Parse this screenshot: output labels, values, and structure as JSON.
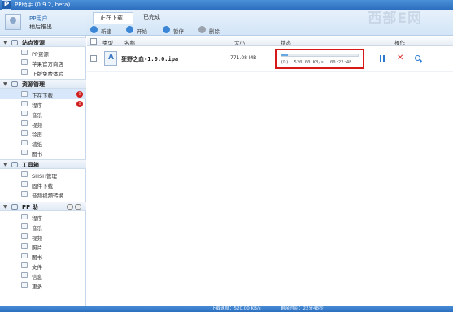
{
  "app": {
    "title": "PP助手 (0.9.2, beta)",
    "logo": "P",
    "watermark": "西部E网"
  },
  "user": {
    "name": "PP用户",
    "logout_label": "稍后推出"
  },
  "sidebar": {
    "sections": [
      {
        "title": "站点资源",
        "items": [
          {
            "label": "PP资源",
            "icon": "pp-resource-icon"
          },
          {
            "label": "苹果官方商店",
            "icon": "apple-store-icon"
          },
          {
            "label": "正版免费体验",
            "icon": "free-trial-icon"
          }
        ]
      },
      {
        "title": "资源管理",
        "items": [
          {
            "label": "正在下载",
            "icon": "download-icon",
            "badge": "!"
          },
          {
            "label": "程序",
            "icon": "app-icon",
            "badge": "!"
          },
          {
            "label": "音乐",
            "icon": "music-icon"
          },
          {
            "label": "视频",
            "icon": "video-icon"
          },
          {
            "label": "铃声",
            "icon": "ringtone-icon"
          },
          {
            "label": "墙纸",
            "icon": "wallpaper-icon"
          },
          {
            "label": "图书",
            "icon": "book-icon"
          }
        ]
      },
      {
        "title": "工具箱",
        "items": [
          {
            "label": "SHSH管理",
            "icon": "shsh-icon"
          },
          {
            "label": "固件下载",
            "icon": "firmware-icon"
          },
          {
            "label": "音频视频转换",
            "icon": "convert-icon"
          }
        ]
      },
      {
        "title": "PP 助",
        "items": [
          {
            "label": "程序",
            "icon": "app-icon"
          },
          {
            "label": "音乐",
            "icon": "music-icon"
          },
          {
            "label": "视频",
            "icon": "video-icon"
          },
          {
            "label": "照片",
            "icon": "photo-icon"
          },
          {
            "label": "图书",
            "icon": "book-icon"
          },
          {
            "label": "文件",
            "icon": "file-icon"
          },
          {
            "label": "信息",
            "icon": "message-icon"
          },
          {
            "label": "更多",
            "icon": "more-icon"
          }
        ]
      }
    ]
  },
  "tabs": {
    "downloading": "正在下载",
    "completed": "已完成"
  },
  "toolbar": {
    "new_label": "新建",
    "start_label": "开始",
    "pause_label": "暂停",
    "delete_label": "删除"
  },
  "table": {
    "headers": {
      "type": "类型",
      "name": "名称",
      "size": "大小",
      "status": "状态",
      "actions": "操作"
    },
    "rows": [
      {
        "name": "狂野之血-1.0.0.ipa",
        "size": "771.08 MB",
        "speed": "(D): 520.00 KB/s",
        "remaining": "00:22:48",
        "progress": 0.08
      }
    ]
  },
  "statusbar": {
    "speed": "下载速度：520.00 KB/s",
    "remaining": "剩余时间：22分48秒"
  }
}
